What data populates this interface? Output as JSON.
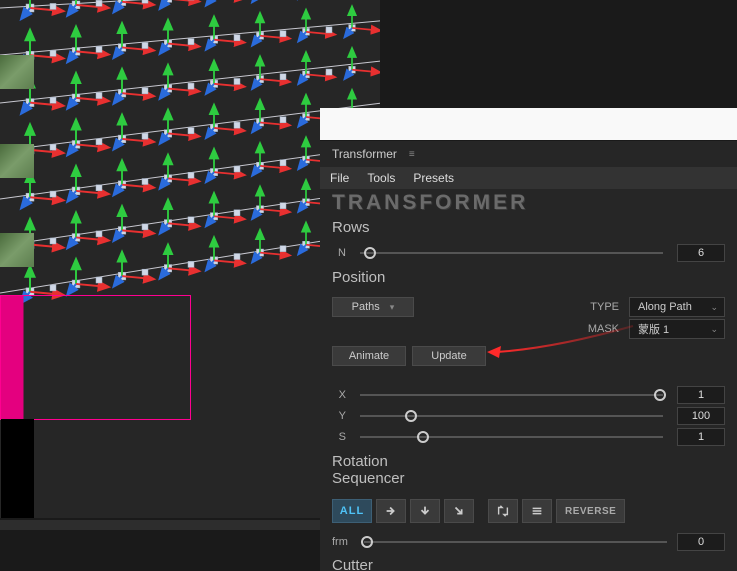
{
  "panel": {
    "title": "Transformer",
    "menu": {
      "file": "File",
      "tools": "Tools",
      "presets": "Presets"
    },
    "logo": "TRANSFORMER"
  },
  "rows": {
    "title": "Rows",
    "n_label": "N",
    "n_value": "6",
    "n_slider_pct": 5
  },
  "position": {
    "title": "Position",
    "paths_label": "Paths",
    "type_label": "TYPE",
    "type_value": "Along Path",
    "mask_label": "MASK",
    "mask_value": "蒙版 1",
    "animate_label": "Animate",
    "update_label": "Update",
    "x_label": "X",
    "x_value": "1",
    "x_slider_pct": 97,
    "y_label": "Y",
    "y_value": "100",
    "y_slider_pct": 18,
    "s_label": "S",
    "s_value": "1",
    "s_slider_pct": 22
  },
  "rotation": {
    "title1": "Rotation",
    "title2": "Sequencer",
    "all_label": "ALL",
    "reverse_label": "REVERSE",
    "frm_label": "frm",
    "frm_value": "0",
    "frm_slider_pct": 3
  },
  "cutter": {
    "title": "Cutter"
  }
}
